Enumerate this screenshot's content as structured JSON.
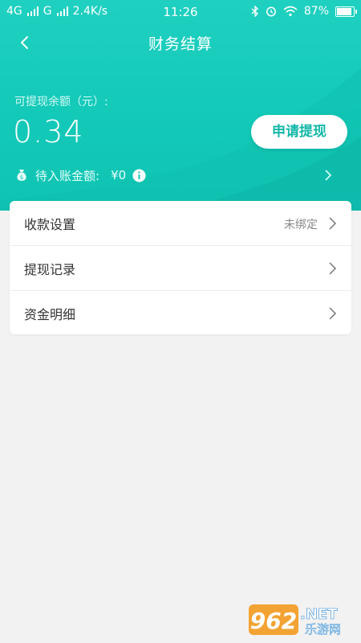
{
  "status_bar": {
    "network1": "4G",
    "network2": "G",
    "speed": "2.4K/s",
    "time": "11:26",
    "battery": "87%"
  },
  "nav": {
    "title": "财务结算"
  },
  "balance": {
    "label": "可提现余额（元）:",
    "value": "0.34",
    "withdraw_button": "申请提现",
    "pending_label": "待入账金额:",
    "pending_value": "¥0"
  },
  "menu": [
    {
      "label": "收款设置",
      "value": "未绑定"
    },
    {
      "label": "提现记录",
      "value": ""
    },
    {
      "label": "资金明细",
      "value": ""
    }
  ],
  "watermark": {
    "num": "962",
    "net": ".NET",
    "cn": "乐游网"
  },
  "colors": {
    "primary": "#13c9b8",
    "button_text": "#12b7a8",
    "background": "#f2f2f2"
  }
}
